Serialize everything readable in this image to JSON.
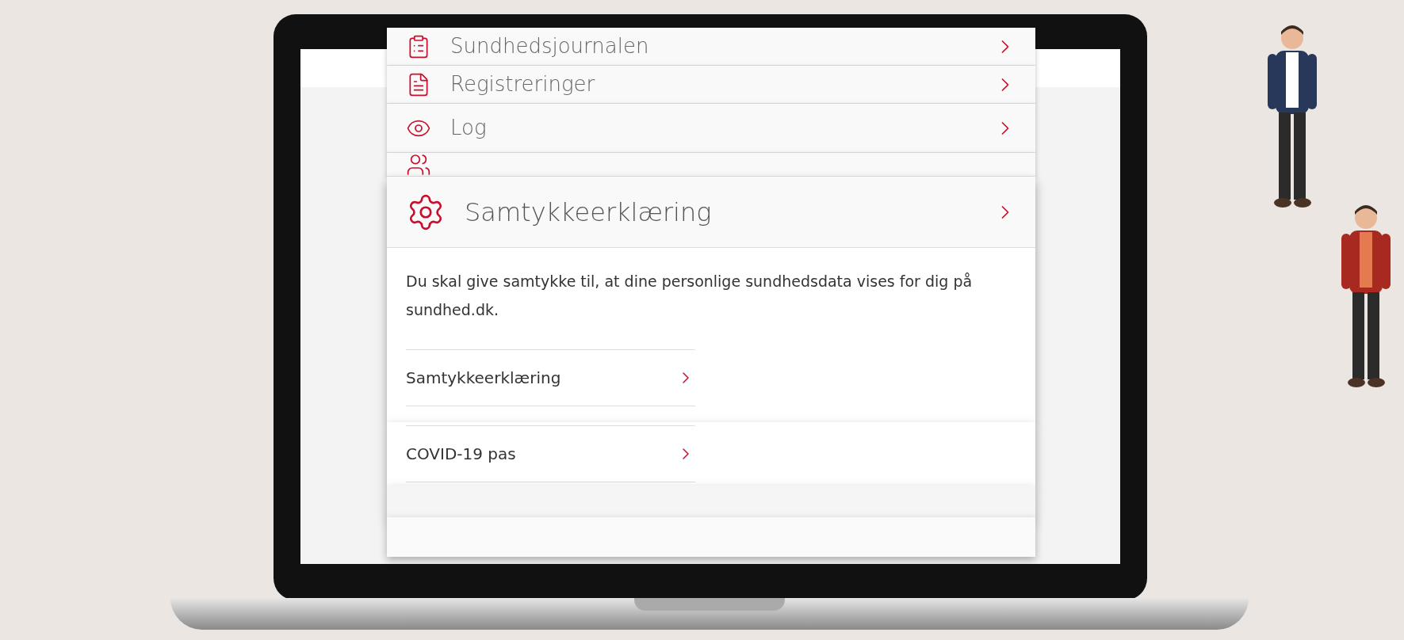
{
  "header_cards": [
    {
      "kind": "clipboard",
      "title": "Sundhedsjournalen"
    },
    {
      "kind": "document",
      "title": "Registreringer"
    },
    {
      "kind": "eye",
      "title": "Log"
    },
    {
      "kind": "people"
    }
  ],
  "main_card": {
    "kind": "gear",
    "title": "Samtykkeerklæring",
    "text": "Du skal give samtykke til, at dine personlige sundhedsdata vises for dig på sundhed.dk.",
    "links": [
      "Samtykkeerklæring"
    ]
  },
  "lower_card": {
    "links": [
      "COVID-19 pas"
    ]
  }
}
